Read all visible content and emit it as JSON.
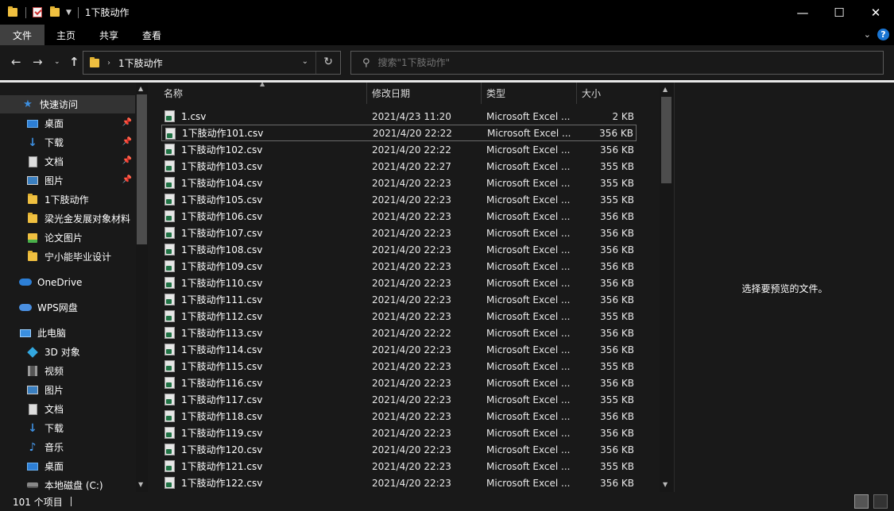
{
  "window": {
    "title": "1下肢动作",
    "controls": {
      "minimize": "—",
      "maximize": "☐",
      "close": "✕"
    }
  },
  "ribbon": {
    "tabs": [
      {
        "label": "文件",
        "active": true
      },
      {
        "label": "主页"
      },
      {
        "label": "共享"
      },
      {
        "label": "查看"
      }
    ],
    "help_label": "?"
  },
  "address": {
    "path": "1下肢动作",
    "search_placeholder": "搜索\"1下肢动作\""
  },
  "sidebar": {
    "items": [
      {
        "label": "快速访问",
        "icon": "star-icon",
        "selected": true
      },
      {
        "label": "桌面",
        "icon": "desktop-icon",
        "pinned": true
      },
      {
        "label": "下载",
        "icon": "download-icon",
        "pinned": true
      },
      {
        "label": "文档",
        "icon": "document-icon",
        "pinned": true
      },
      {
        "label": "图片",
        "icon": "pictures-icon",
        "pinned": true
      },
      {
        "label": "1下肢动作",
        "icon": "folder-icon"
      },
      {
        "label": "梁光金发展对象材料",
        "icon": "folder-icon"
      },
      {
        "label": "论文图片",
        "icon": "image-folder-icon"
      },
      {
        "label": "宁小能毕业设计",
        "icon": "folder-icon"
      },
      {
        "label": "OneDrive",
        "icon": "onedrive-icon"
      },
      {
        "label": "WPS网盘",
        "icon": "wps-cloud-icon"
      },
      {
        "label": "此电脑",
        "icon": "computer-icon"
      },
      {
        "label": "3D 对象",
        "icon": "3d-objects-icon"
      },
      {
        "label": "视频",
        "icon": "video-icon"
      },
      {
        "label": "图片",
        "icon": "pictures-icon"
      },
      {
        "label": "文档",
        "icon": "document-icon"
      },
      {
        "label": "下载",
        "icon": "download-icon"
      },
      {
        "label": "音乐",
        "icon": "music-icon"
      },
      {
        "label": "桌面",
        "icon": "desktop-icon"
      },
      {
        "label": "本地磁盘 (C:)",
        "icon": "disk-icon"
      }
    ]
  },
  "columns": {
    "name": "名称",
    "date": "修改日期",
    "type": "类型",
    "size": "大小"
  },
  "files": [
    {
      "name": "1.csv",
      "date": "2021/4/23 11:20",
      "type": "Microsoft Excel ...",
      "size": "2 KB"
    },
    {
      "name": "1下肢动作101.csv",
      "date": "2021/4/20 22:22",
      "type": "Microsoft Excel ...",
      "size": "356 KB"
    },
    {
      "name": "1下肢动作102.csv",
      "date": "2021/4/20 22:22",
      "type": "Microsoft Excel ...",
      "size": "356 KB"
    },
    {
      "name": "1下肢动作103.csv",
      "date": "2021/4/20 22:27",
      "type": "Microsoft Excel ...",
      "size": "355 KB"
    },
    {
      "name": "1下肢动作104.csv",
      "date": "2021/4/20 22:23",
      "type": "Microsoft Excel ...",
      "size": "355 KB"
    },
    {
      "name": "1下肢动作105.csv",
      "date": "2021/4/20 22:23",
      "type": "Microsoft Excel ...",
      "size": "355 KB"
    },
    {
      "name": "1下肢动作106.csv",
      "date": "2021/4/20 22:23",
      "type": "Microsoft Excel ...",
      "size": "356 KB"
    },
    {
      "name": "1下肢动作107.csv",
      "date": "2021/4/20 22:23",
      "type": "Microsoft Excel ...",
      "size": "356 KB"
    },
    {
      "name": "1下肢动作108.csv",
      "date": "2021/4/20 22:23",
      "type": "Microsoft Excel ...",
      "size": "356 KB"
    },
    {
      "name": "1下肢动作109.csv",
      "date": "2021/4/20 22:23",
      "type": "Microsoft Excel ...",
      "size": "356 KB"
    },
    {
      "name": "1下肢动作110.csv",
      "date": "2021/4/20 22:23",
      "type": "Microsoft Excel ...",
      "size": "356 KB"
    },
    {
      "name": "1下肢动作111.csv",
      "date": "2021/4/20 22:23",
      "type": "Microsoft Excel ...",
      "size": "356 KB"
    },
    {
      "name": "1下肢动作112.csv",
      "date": "2021/4/20 22:23",
      "type": "Microsoft Excel ...",
      "size": "355 KB"
    },
    {
      "name": "1下肢动作113.csv",
      "date": "2021/4/20 22:22",
      "type": "Microsoft Excel ...",
      "size": "356 KB"
    },
    {
      "name": "1下肢动作114.csv",
      "date": "2021/4/20 22:23",
      "type": "Microsoft Excel ...",
      "size": "356 KB"
    },
    {
      "name": "1下肢动作115.csv",
      "date": "2021/4/20 22:23",
      "type": "Microsoft Excel ...",
      "size": "355 KB"
    },
    {
      "name": "1下肢动作116.csv",
      "date": "2021/4/20 22:23",
      "type": "Microsoft Excel ...",
      "size": "356 KB"
    },
    {
      "name": "1下肢动作117.csv",
      "date": "2021/4/20 22:23",
      "type": "Microsoft Excel ...",
      "size": "355 KB"
    },
    {
      "name": "1下肢动作118.csv",
      "date": "2021/4/20 22:23",
      "type": "Microsoft Excel ...",
      "size": "356 KB"
    },
    {
      "name": "1下肢动作119.csv",
      "date": "2021/4/20 22:23",
      "type": "Microsoft Excel ...",
      "size": "356 KB"
    },
    {
      "name": "1下肢动作120.csv",
      "date": "2021/4/20 22:23",
      "type": "Microsoft Excel ...",
      "size": "356 KB"
    },
    {
      "name": "1下肢动作121.csv",
      "date": "2021/4/20 22:23",
      "type": "Microsoft Excel ...",
      "size": "355 KB"
    },
    {
      "name": "1下肢动作122.csv",
      "date": "2021/4/20 22:23",
      "type": "Microsoft Excel ...",
      "size": "356 KB"
    }
  ],
  "preview": {
    "message": "选择要预览的文件。"
  },
  "status": {
    "item_count": "101 个项目"
  },
  "colors": {
    "background": "#191919",
    "titlebar": "#000000",
    "accent": "#1a75d2"
  }
}
